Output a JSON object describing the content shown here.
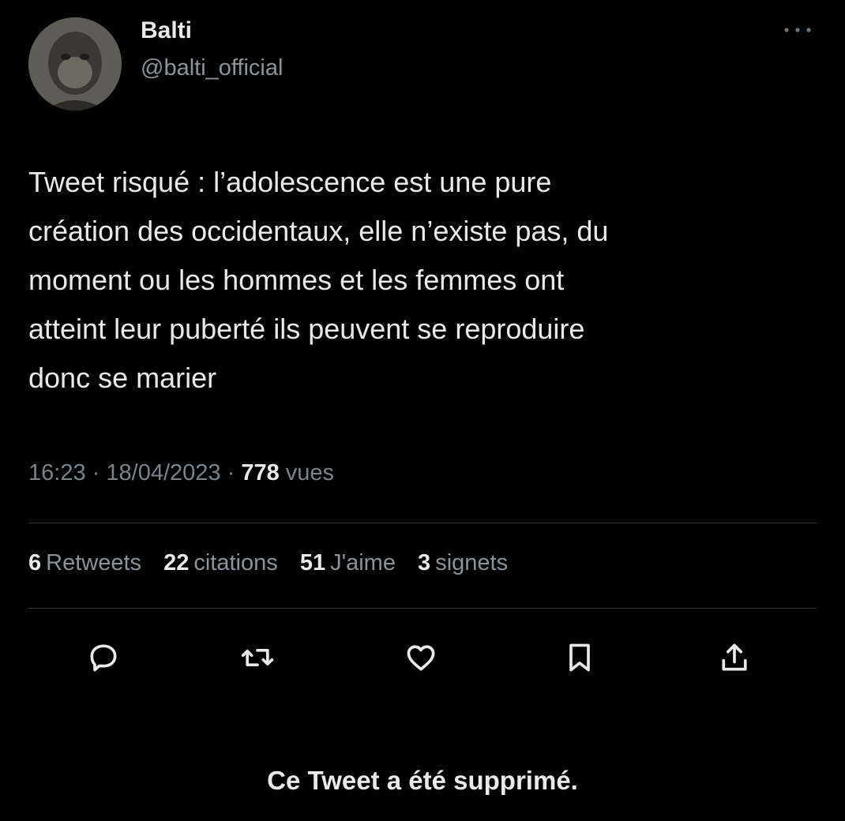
{
  "author": {
    "name": "Balti",
    "handle": "@balti_official"
  },
  "tweet": {
    "lines": [
      "Tweet risqué : l’adolescence est une pure",
      "création des occidentaux, elle n’existe pas, du",
      "moment ou les hommes et les femmes ont",
      "atteint leur puberté ils peuvent se reproduire",
      "donc se marier"
    ]
  },
  "meta": {
    "time": "16:23",
    "separator": "·",
    "date": "18/04/2023",
    "views_count": "778",
    "views_label": "vues"
  },
  "stats": {
    "retweets_count": "6",
    "retweets_label": "Retweets",
    "quotes_count": "22",
    "quotes_label": "citations",
    "likes_count": "51",
    "likes_label": "J'aime",
    "bookmarks_count": "3",
    "bookmarks_label": "signets"
  },
  "actions": [
    "reply-icon",
    "retweet-icon",
    "like-icon",
    "bookmark-icon",
    "share-icon"
  ],
  "footer": {
    "deleted_notice": "Ce Tweet a été supprimé."
  },
  "colors": {
    "background": "#000000",
    "text": "#e7e9ea",
    "secondary": "#8b9299"
  }
}
